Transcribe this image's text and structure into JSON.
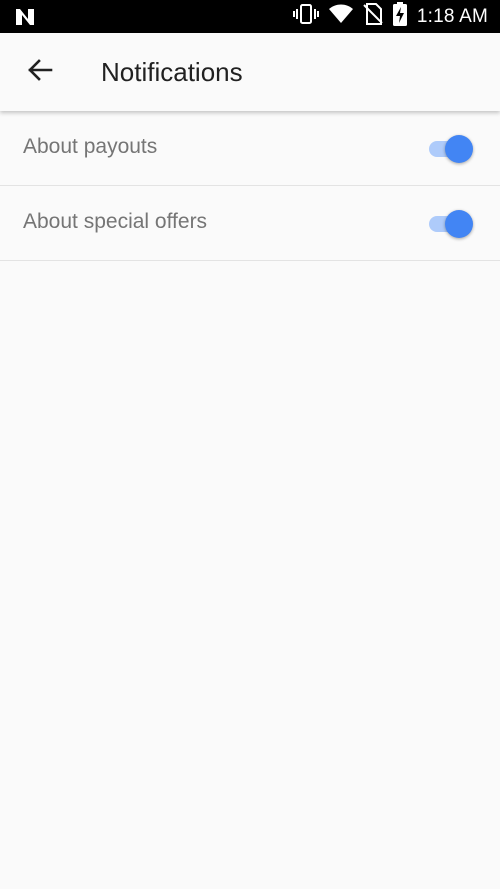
{
  "status_bar": {
    "time": "1:18 AM",
    "icons": [
      "n-logo-icon",
      "vibrate-icon",
      "wifi-icon",
      "no-sim-icon",
      "battery-charging-icon"
    ]
  },
  "app_bar": {
    "title": "Notifications",
    "back_icon": "arrow-left-icon"
  },
  "settings": [
    {
      "label": "About payouts",
      "enabled": true
    },
    {
      "label": "About special offers",
      "enabled": true
    }
  ],
  "colors": {
    "switch_on_thumb": "#4285f4",
    "switch_on_track": "#aecbfa",
    "background": "#fafafa",
    "status_bar": "#000000"
  }
}
